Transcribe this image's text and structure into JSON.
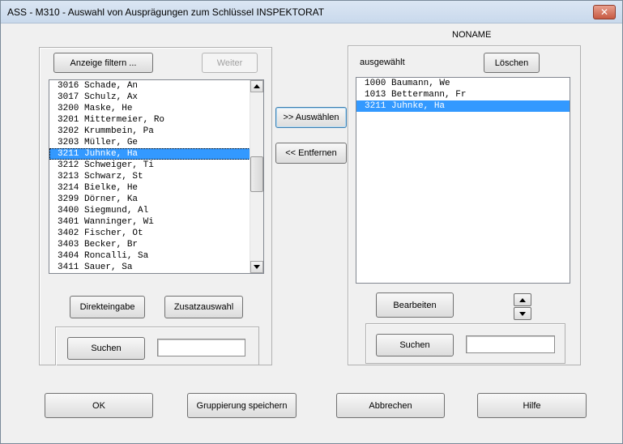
{
  "window": {
    "title": "ASS - M310 - Auswahl von Ausprägungen zum Schlüssel INSPEKTORAT",
    "close_symbol": "✕"
  },
  "header": {
    "noname_label": "NONAME"
  },
  "left": {
    "filter_button": "Anzeige filtern ...",
    "next_button": "Weiter",
    "items": [
      "3016 Schade, An",
      "3017 Schulz, Ax",
      "3200 Maske, He",
      "3201 Mittermeier, Ro",
      "3202 Krummbein, Pa",
      "3203 Müller, Ge",
      "3211 Juhnke, Ha",
      "3212 Schweiger, Ti",
      "3213 Schwarz, St",
      "3214 Bielke, He",
      "3299 Dörner, Ka",
      "3400 Siegmund, Al",
      "3401 Wanninger, Wi",
      "3402 Fischer, Ot",
      "3403 Becker, Br",
      "3404 Roncalli, Sa",
      "3411 Sauer, Sa"
    ],
    "selected_item": "3211 Juhnke, Ha",
    "direct_input_button": "Direkteingabe",
    "extra_selection_button": "Zusatzauswahl",
    "search_button": "Suchen",
    "search_value": ""
  },
  "middle": {
    "select_button": ">> Auswählen",
    "remove_button": "<< Entfernen"
  },
  "right": {
    "selected_label": "ausgewählt",
    "clear_button": "Löschen",
    "items": [
      "1000 Baumann, We",
      "1013 Bettermann, Fr",
      "3211 Juhnke, Ha"
    ],
    "selected_item": "3211 Juhnke, Ha",
    "edit_button": "Bearbeiten",
    "search_button": "Suchen",
    "search_value": ""
  },
  "footer": {
    "ok_button": "OK",
    "save_group_button": "Gruppierung speichern",
    "cancel_button": "Abbrechen",
    "help_button": "Hilfe"
  },
  "colors": {
    "selection": "#3399ff",
    "dialog_background": "#f0f0f0",
    "close_button": "#c75a43"
  },
  "icons": {
    "close": "close-icon",
    "scroll_up": "arrow-up-icon",
    "scroll_down": "arrow-down-icon",
    "move_up": "arrow-up-icon",
    "move_down": "arrow-down-icon"
  }
}
